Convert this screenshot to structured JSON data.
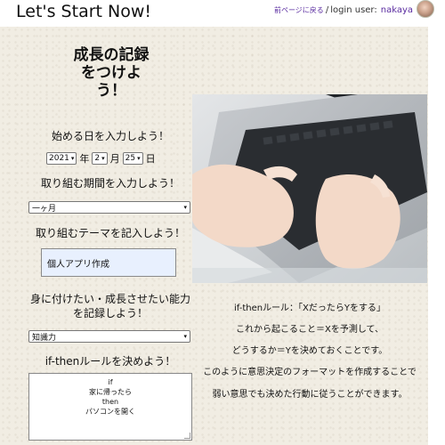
{
  "header": {
    "title": "Let's Start Now!",
    "back_link": "前ページに戻る",
    "separator": "/",
    "login_label": "login user:",
    "username": "nakaya"
  },
  "page": {
    "title": "成長の記録をつけよう！"
  },
  "start_date": {
    "label": "始める日を入力しよう！",
    "year": "2021",
    "year_unit": "年",
    "month": "2",
    "month_unit": "月",
    "day": "25",
    "day_unit": "日"
  },
  "period": {
    "label": "取り組む期間を入力しよう！",
    "selected": "一ヶ月"
  },
  "theme": {
    "label": "取り組むテーマを記入しよう！",
    "value": "個人アプリ作成"
  },
  "ability": {
    "label": "身に付けたい・成長させたい能力を記録しよう！",
    "selected": "知識力"
  },
  "if_then": {
    "label": "if-thenルールを決めよう！",
    "lines": [
      "if",
      "家に帰ったら",
      "then",
      "パソコンを開く"
    ]
  },
  "explanation": {
    "lines": [
      "if-thenルール：「XだったらYをする」",
      "これから起こること＝Xを予測して、",
      "どうするか＝Yを決めておくことです。",
      "このように意思決定のフォーマットを作成することで",
      "弱い意思でも決めた行動に従うことができます。"
    ]
  },
  "colors": {
    "paper": "#f1ede3",
    "link": "#5a2ca0",
    "input_fill": "#e8f0fe"
  },
  "icons": {
    "chevron": "chevron-down-icon",
    "photo": "laptop-typing-photo"
  }
}
